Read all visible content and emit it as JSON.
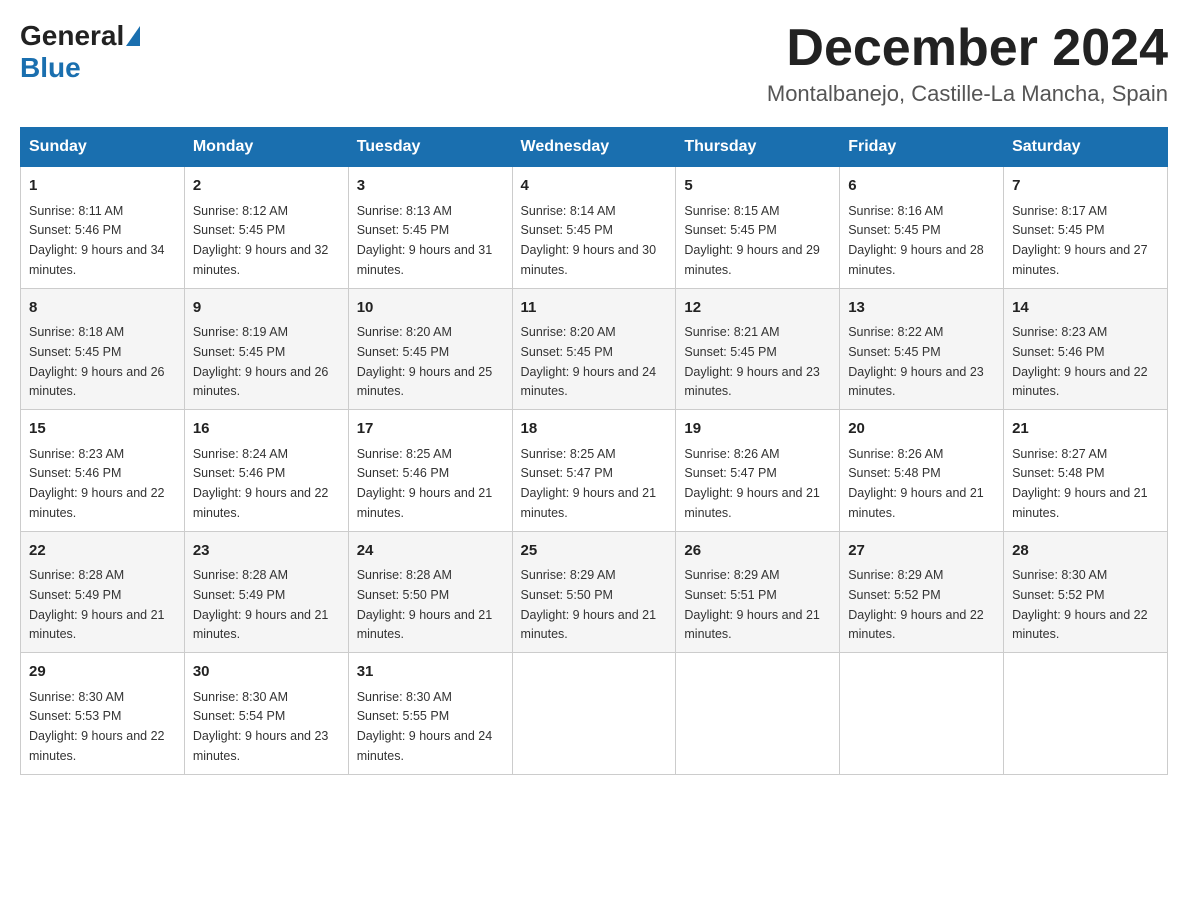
{
  "logo": {
    "text_general": "General",
    "text_blue": "Blue"
  },
  "header": {
    "month": "December 2024",
    "location": "Montalbanejo, Castille-La Mancha, Spain"
  },
  "days_of_week": [
    "Sunday",
    "Monday",
    "Tuesday",
    "Wednesday",
    "Thursday",
    "Friday",
    "Saturday"
  ],
  "weeks": [
    [
      {
        "day": "1",
        "sunrise": "8:11 AM",
        "sunset": "5:46 PM",
        "daylight": "9 hours and 34 minutes."
      },
      {
        "day": "2",
        "sunrise": "8:12 AM",
        "sunset": "5:45 PM",
        "daylight": "9 hours and 32 minutes."
      },
      {
        "day": "3",
        "sunrise": "8:13 AM",
        "sunset": "5:45 PM",
        "daylight": "9 hours and 31 minutes."
      },
      {
        "day": "4",
        "sunrise": "8:14 AM",
        "sunset": "5:45 PM",
        "daylight": "9 hours and 30 minutes."
      },
      {
        "day": "5",
        "sunrise": "8:15 AM",
        "sunset": "5:45 PM",
        "daylight": "9 hours and 29 minutes."
      },
      {
        "day": "6",
        "sunrise": "8:16 AM",
        "sunset": "5:45 PM",
        "daylight": "9 hours and 28 minutes."
      },
      {
        "day": "7",
        "sunrise": "8:17 AM",
        "sunset": "5:45 PM",
        "daylight": "9 hours and 27 minutes."
      }
    ],
    [
      {
        "day": "8",
        "sunrise": "8:18 AM",
        "sunset": "5:45 PM",
        "daylight": "9 hours and 26 minutes."
      },
      {
        "day": "9",
        "sunrise": "8:19 AM",
        "sunset": "5:45 PM",
        "daylight": "9 hours and 26 minutes."
      },
      {
        "day": "10",
        "sunrise": "8:20 AM",
        "sunset": "5:45 PM",
        "daylight": "9 hours and 25 minutes."
      },
      {
        "day": "11",
        "sunrise": "8:20 AM",
        "sunset": "5:45 PM",
        "daylight": "9 hours and 24 minutes."
      },
      {
        "day": "12",
        "sunrise": "8:21 AM",
        "sunset": "5:45 PM",
        "daylight": "9 hours and 23 minutes."
      },
      {
        "day": "13",
        "sunrise": "8:22 AM",
        "sunset": "5:45 PM",
        "daylight": "9 hours and 23 minutes."
      },
      {
        "day": "14",
        "sunrise": "8:23 AM",
        "sunset": "5:46 PM",
        "daylight": "9 hours and 22 minutes."
      }
    ],
    [
      {
        "day": "15",
        "sunrise": "8:23 AM",
        "sunset": "5:46 PM",
        "daylight": "9 hours and 22 minutes."
      },
      {
        "day": "16",
        "sunrise": "8:24 AM",
        "sunset": "5:46 PM",
        "daylight": "9 hours and 22 minutes."
      },
      {
        "day": "17",
        "sunrise": "8:25 AM",
        "sunset": "5:46 PM",
        "daylight": "9 hours and 21 minutes."
      },
      {
        "day": "18",
        "sunrise": "8:25 AM",
        "sunset": "5:47 PM",
        "daylight": "9 hours and 21 minutes."
      },
      {
        "day": "19",
        "sunrise": "8:26 AM",
        "sunset": "5:47 PM",
        "daylight": "9 hours and 21 minutes."
      },
      {
        "day": "20",
        "sunrise": "8:26 AM",
        "sunset": "5:48 PM",
        "daylight": "9 hours and 21 minutes."
      },
      {
        "day": "21",
        "sunrise": "8:27 AM",
        "sunset": "5:48 PM",
        "daylight": "9 hours and 21 minutes."
      }
    ],
    [
      {
        "day": "22",
        "sunrise": "8:28 AM",
        "sunset": "5:49 PM",
        "daylight": "9 hours and 21 minutes."
      },
      {
        "day": "23",
        "sunrise": "8:28 AM",
        "sunset": "5:49 PM",
        "daylight": "9 hours and 21 minutes."
      },
      {
        "day": "24",
        "sunrise": "8:28 AM",
        "sunset": "5:50 PM",
        "daylight": "9 hours and 21 minutes."
      },
      {
        "day": "25",
        "sunrise": "8:29 AM",
        "sunset": "5:50 PM",
        "daylight": "9 hours and 21 minutes."
      },
      {
        "day": "26",
        "sunrise": "8:29 AM",
        "sunset": "5:51 PM",
        "daylight": "9 hours and 21 minutes."
      },
      {
        "day": "27",
        "sunrise": "8:29 AM",
        "sunset": "5:52 PM",
        "daylight": "9 hours and 22 minutes."
      },
      {
        "day": "28",
        "sunrise": "8:30 AM",
        "sunset": "5:52 PM",
        "daylight": "9 hours and 22 minutes."
      }
    ],
    [
      {
        "day": "29",
        "sunrise": "8:30 AM",
        "sunset": "5:53 PM",
        "daylight": "9 hours and 22 minutes."
      },
      {
        "day": "30",
        "sunrise": "8:30 AM",
        "sunset": "5:54 PM",
        "daylight": "9 hours and 23 minutes."
      },
      {
        "day": "31",
        "sunrise": "8:30 AM",
        "sunset": "5:55 PM",
        "daylight": "9 hours and 24 minutes."
      },
      null,
      null,
      null,
      null
    ]
  ]
}
